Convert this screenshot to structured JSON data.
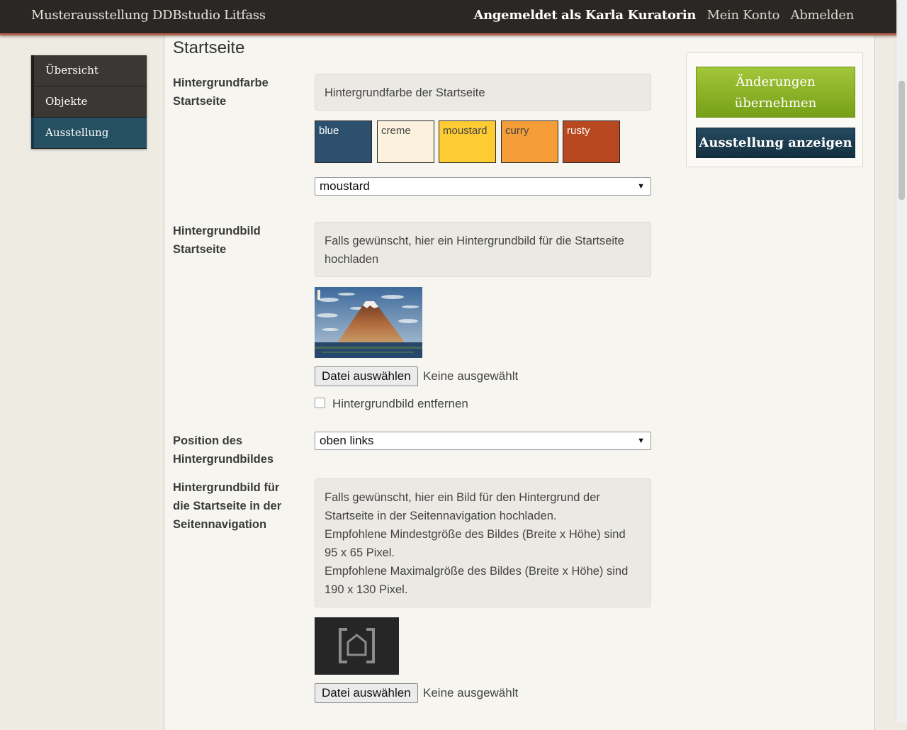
{
  "header": {
    "site_title": "Musterausstellung DDBstudio Litfass",
    "logged_in_text": "Angemeldet als Karla Kuratorin",
    "my_account": "Mein Konto",
    "logout": "Abmelden"
  },
  "sidebar": {
    "items": [
      {
        "label": "Übersicht"
      },
      {
        "label": "Objekte"
      },
      {
        "label": "Ausstellung",
        "active": true
      }
    ]
  },
  "main": {
    "heading": "Startseite",
    "background_color": {
      "label": "Hintergrundfarbe Startseite",
      "help": "Hintergrundfarbe der Startseite",
      "swatches": [
        {
          "label": "blue",
          "color": "#2c506d",
          "text_color": "#ffffff"
        },
        {
          "label": "creme",
          "color": "#fcf1dc",
          "text_color": "#444444"
        },
        {
          "label": "moustard",
          "color": "#fecb33",
          "text_color": "#444444"
        },
        {
          "label": "curry",
          "color": "#f59d38",
          "text_color": "#444444"
        },
        {
          "label": "rusty",
          "color": "#b7481f",
          "text_color": "#ffffff"
        }
      ],
      "selected": "moustard"
    },
    "background_image": {
      "label": "Hintergrundbild Startseite",
      "help": "Falls gewünscht, hier ein Hintergrundbild für die Startseite hochladen",
      "thumbnail_icon": "mount-fuji-woodblock-thumbnail",
      "file_button": "Datei auswählen",
      "file_status": "Keine ausgewählt",
      "remove_label": "Hintergrundbild entfernen"
    },
    "position": {
      "label": "Position des Hintergrundbildes",
      "selected": "oben links"
    },
    "nav_image": {
      "label": "Hintergrundbild für die Startseite in der Seitennavigation",
      "help_line1": "Falls gewünscht, hier ein Bild für den Hintergrund der Startseite in der Seitennavigation hochladen.",
      "help_line2": "Empfohlene Mindestgröße des Bildes (Breite x Höhe) sind 95 x 65 Pixel.",
      "help_line3": "Empfohlene Maximalgröße des Bildes (Breite x Höhe) sind 190 x 130 Pixel.",
      "thumbnail_icon": "home-icon",
      "file_button": "Datei auswählen",
      "file_status": "Keine ausgewählt"
    }
  },
  "actions": {
    "apply": "Änderungen übernehmen",
    "show": "Ausstellung anzeigen"
  },
  "colors": {
    "apply_green": "#8bb42a",
    "show_blue": "#1c3f52",
    "nav_active": "#255062",
    "header_accent": "#b8614a"
  }
}
